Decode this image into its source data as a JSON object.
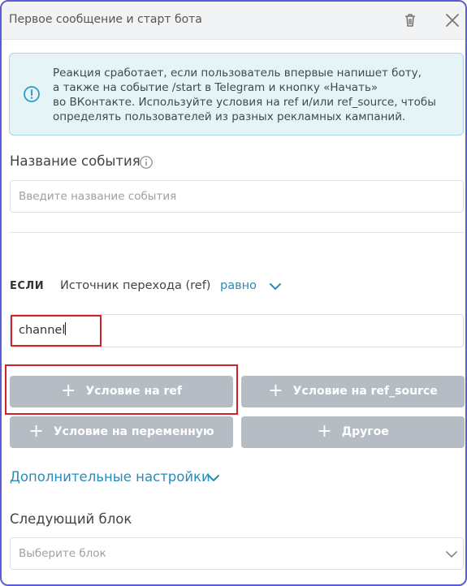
{
  "header": {
    "title": "Первое сообщение и старт бота",
    "delete_icon": "trash-icon",
    "close_icon": "close-icon"
  },
  "info": {
    "icon": "info-circle-icon",
    "lines": [
      "Реакция сработает, если пользователь впервые напишет боту,",
      "а также на событие /start в Telegram и кнопку «Начать»",
      "во ВКонтакте. Используйте условия на ref и/или ref_source, чтобы",
      "определять пользователей из разных рекламных кампаний."
    ]
  },
  "event_name": {
    "label": "Название события",
    "placeholder": "Введите название события"
  },
  "condition": {
    "if_label": "ЕСЛИ",
    "source": "Источник перехода (ref)",
    "operator": "равно",
    "value": "channel"
  },
  "buttons": {
    "ref": "Условие на ref",
    "ref_source": "Условие на ref_source",
    "variable": "Условие на переменную",
    "other": "Другое"
  },
  "advanced": {
    "label": "Дополнительные настройки"
  },
  "next_block": {
    "label": "Следующий блок",
    "placeholder": "Выберите блок"
  },
  "colors": {
    "accent": "#2a8bb6",
    "button_bg": "#b5bcc4",
    "highlight": "#d0222b",
    "info_bg": "#e6f4f8"
  }
}
